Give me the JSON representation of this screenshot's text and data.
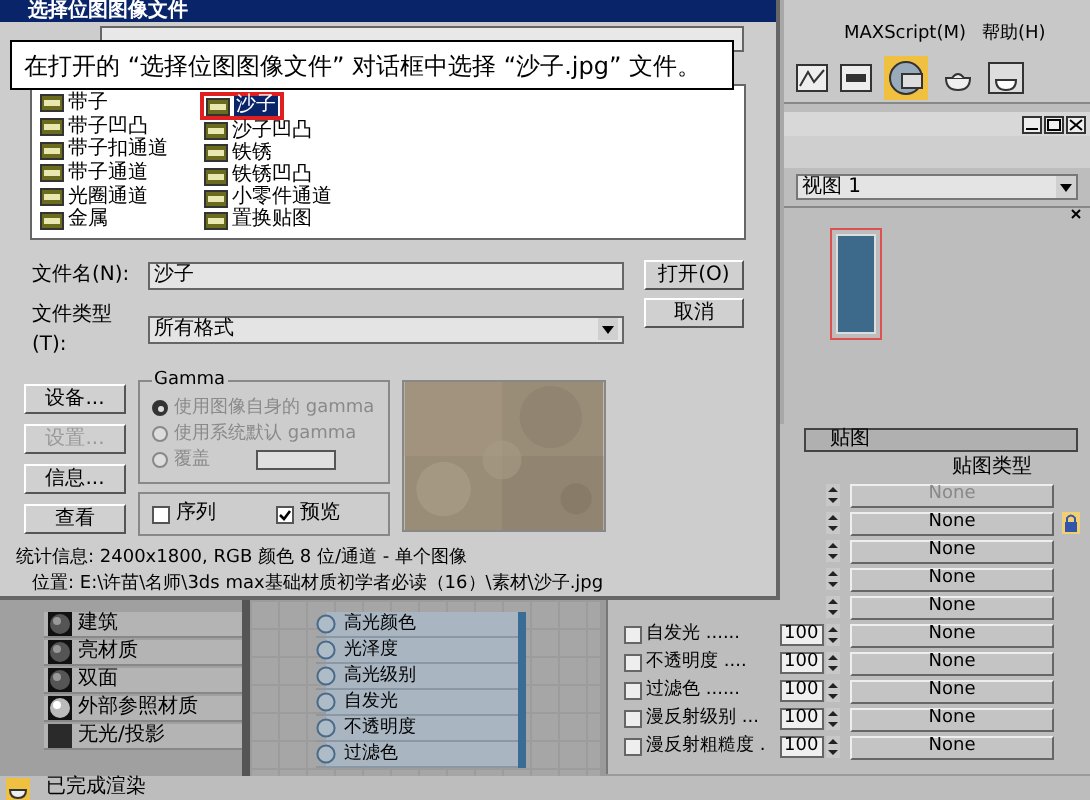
{
  "dialog": {
    "title": "选择位图图像文件",
    "banner": "在打开的 “选择位图图像文件” 对话框中选择 “沙子.jpg” 文件。",
    "files": [
      {
        "name": "带子",
        "selected": false
      },
      {
        "name": "带子凹凸",
        "selected": false
      },
      {
        "name": "带子扣通道",
        "selected": false
      },
      {
        "name": "带子通道",
        "selected": false
      },
      {
        "name": "光圈通道",
        "selected": false
      },
      {
        "name": "金属",
        "selected": false
      },
      {
        "name": "沙子",
        "selected": true
      },
      {
        "name": "沙子凹凸",
        "selected": false
      },
      {
        "name": "铁锈",
        "selected": false
      },
      {
        "name": "铁锈凹凸",
        "selected": false
      },
      {
        "name": "小零件通道",
        "selected": false
      },
      {
        "name": "置换贴图",
        "selected": false
      }
    ],
    "file_name_label": "文件名(N):",
    "file_name": "沙子",
    "file_type_label": "文件类型(T):",
    "file_type": "所有格式",
    "open_button": "打开(O)",
    "cancel_button": "取消",
    "side_buttons": [
      {
        "label": "设备...",
        "disabled": false
      },
      {
        "label": "设置...",
        "disabled": true
      },
      {
        "label": "信息...",
        "disabled": false
      },
      {
        "label": "查看",
        "disabled": false
      }
    ],
    "gamma": {
      "title": "Gamma",
      "disabled": true,
      "options": [
        {
          "label": "使用图像自身的 gamma",
          "selected": true
        },
        {
          "label": "使用系统默认 gamma",
          "selected": false
        },
        {
          "label": "覆盖",
          "selected": false
        }
      ]
    },
    "sequence": {
      "label": "序列",
      "checked": false
    },
    "preview": {
      "label": "预览",
      "checked": true
    },
    "stats": "统计信息: 2400x1800, RGB 颜色 8 位/通道 - 单个图像",
    "location": "位置: E:\\许苗\\名师\\3ds max基础材质初学者必读（16）\\素材\\沙子.jpg"
  },
  "menu": [
    {
      "label": "MAXScript(M)"
    },
    {
      "label": "帮助(H)"
    }
  ],
  "viewport_selector": "视图 1",
  "maps_panel": {
    "title": "贴图",
    "column_header": "贴图类型",
    "rows": [
      {
        "map": "None",
        "disabled": true
      },
      {
        "map": "None",
        "disabled": false
      },
      {
        "map": "None",
        "disabled": false
      },
      {
        "map": "None",
        "disabled": false
      },
      {
        "map": "None",
        "disabled": false
      },
      {
        "label": "自发光 ......",
        "checked": false,
        "amount": "100",
        "map": "None",
        "disabled": false
      },
      {
        "label": "不透明度 ....",
        "checked": false,
        "amount": "100",
        "map": "None",
        "disabled": false
      },
      {
        "label": "过滤色 ......",
        "checked": false,
        "amount": "100",
        "map": "None",
        "disabled": false
      },
      {
        "label": "漫反射级别 ...",
        "checked": false,
        "amount": "100",
        "map": "None",
        "disabled": false
      },
      {
        "label": "漫反射粗糙度 .",
        "checked": false,
        "amount": "100",
        "map": "None",
        "disabled": false
      }
    ]
  },
  "materials": [
    {
      "name": "建筑",
      "kind": "sphere"
    },
    {
      "name": "亮材质",
      "kind": "sphere"
    },
    {
      "name": "双面",
      "kind": "sphere"
    },
    {
      "name": "外部参照材质",
      "kind": "bright"
    },
    {
      "name": "无光/投影",
      "kind": "flat"
    }
  ],
  "node_slots": [
    "高光颜色",
    "光泽度",
    "高光级别",
    "自发光",
    "不透明度",
    "过滤色"
  ],
  "status": "已完成渲染"
}
